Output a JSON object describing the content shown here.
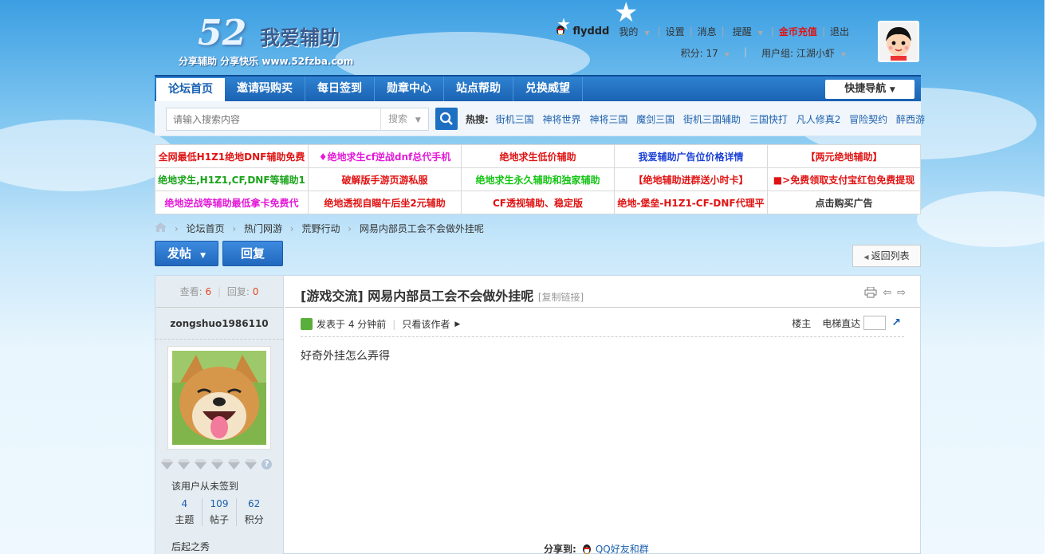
{
  "logo": {
    "number": "52",
    "name": "我爱辅助",
    "tagline": "分享辅助 分享快乐 www.52fzba.com"
  },
  "user": {
    "name": "flyddd",
    "links": [
      "我的",
      "设置",
      "消息",
      "提醒",
      "金币充值",
      "退出"
    ],
    "points": "积分: 17",
    "group": "用户组: 江湖小虾"
  },
  "nav": {
    "items": [
      "论坛首页",
      "邀请码购买",
      "每日签到",
      "勋章中心",
      "站点帮助",
      "兑换威望"
    ],
    "quick": "快捷导航"
  },
  "search": {
    "placeholder": "请输入搜索内容",
    "type": "搜索",
    "hot_label": "热搜:",
    "hot": [
      "街机三国",
      "神将世界",
      "神将三国",
      "魔剑三国",
      "街机三国辅助",
      "三国快打",
      "凡人修真2",
      "冒险契约",
      "醉西游"
    ]
  },
  "ads": [
    [
      {
        "t": "全网最低H1Z1绝地DNF辅助免费",
        "c": "#e01313"
      },
      {
        "t": "♦绝地求生cf逆战dnf总代手机",
        "c": "#e31ad8"
      },
      {
        "t": "绝地求生低价辅助",
        "c": "#e01313"
      },
      {
        "t": "我爱辅助广告位价格详情",
        "c": "#1a3fd6"
      },
      {
        "t": "【两元绝地辅助】",
        "c": "#e01313"
      }
    ],
    [
      {
        "t": "绝地求生,H1Z1,CF,DNF等辅助1",
        "c": "#1aa31a"
      },
      {
        "t": "破解版手游页游私服",
        "c": "#e01313"
      },
      {
        "t": "绝地求生永久辅助和独家辅助",
        "c": "#12c412"
      },
      {
        "t": "【绝地辅助进群送小时卡】",
        "c": "#e01313"
      },
      {
        "t": "■>免费领取支付宝红包免费提现",
        "c": "#e01313"
      }
    ],
    [
      {
        "t": "绝地逆战等辅助最低拿卡免费代",
        "c": "#e31ad8"
      },
      {
        "t": "绝地透视自瞄午后坐2元辅助",
        "c": "#e01313"
      },
      {
        "t": "CF透视辅助、稳定版",
        "c": "#e01313"
      },
      {
        "t": "绝地-堡垒-H1Z1-CF-DNF代理平",
        "c": "#e01313"
      },
      {
        "t": "点击购买广告",
        "c": "#333333"
      }
    ]
  ],
  "breadcrumb": [
    "论坛首页",
    "热门网游",
    "荒野行动",
    "网易内部员工会不会做外挂呢"
  ],
  "buttons": {
    "post": "发帖",
    "reply": "回复",
    "back": "返回列表"
  },
  "post": {
    "views_label": "查看:",
    "views": "6",
    "replies_label": "回复:",
    "replies": "0",
    "author": "zongshuo1986110",
    "no_sign": "该用户从未签到",
    "counts": [
      {
        "n": "4",
        "l": "主题"
      },
      {
        "n": "109",
        "l": "帖子"
      },
      {
        "n": "62",
        "l": "积分"
      }
    ],
    "rank": "后起之秀",
    "category": "[游戏交流]",
    "title": "网易内部员工会不会做外挂呢",
    "copy_link": "[复制链接]",
    "posted": "发表于 4 分钟前",
    "only_author": "只看该作者",
    "floor_label": "楼主",
    "elevator": "电梯直达",
    "content": "好奇外挂怎么弄得",
    "share_label": "分享到:",
    "share_qq": "QQ好友和群"
  }
}
